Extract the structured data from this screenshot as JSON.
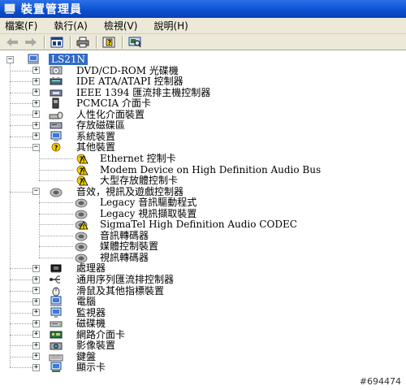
{
  "window": {
    "title": "裝置管理員"
  },
  "menu": [
    {
      "label": "檔案(F)"
    },
    {
      "label": "執行(A)"
    },
    {
      "label": "檢視(V)"
    },
    {
      "label": "說明(H)"
    }
  ],
  "toolbar": {
    "buttons": [
      {
        "icon": "back-arrow-icon"
      },
      {
        "icon": "forward-arrow-icon"
      },
      {
        "icon": "properties-icon"
      },
      {
        "icon": "print-icon"
      },
      {
        "icon": "help-icon"
      },
      {
        "icon": "scan-hardware-icon"
      }
    ]
  },
  "tree": {
    "root": {
      "label": "LS21N",
      "icon": "computer-icon"
    },
    "items": [
      {
        "label": "DVD/CD-ROM 光碟機",
        "icon": "cdrom-icon",
        "state": "collapsed"
      },
      {
        "label": "IDE ATA/ATAPI 控制器",
        "icon": "ide-icon",
        "state": "collapsed"
      },
      {
        "label": "IEEE 1394 匯流排主機控制器",
        "icon": "ieee1394-icon",
        "state": "collapsed"
      },
      {
        "label": "PCMCIA 介面卡",
        "icon": "pcmcia-icon",
        "state": "collapsed"
      },
      {
        "label": "人性化介面裝置",
        "icon": "hid-icon",
        "state": "collapsed"
      },
      {
        "label": "存放磁碟區",
        "icon": "storage-volume-icon",
        "state": "collapsed"
      },
      {
        "label": "系統裝置",
        "icon": "system-device-icon",
        "state": "collapsed"
      },
      {
        "label": "其他裝置",
        "icon": "unknown-device-icon",
        "state": "expanded",
        "children": [
          {
            "label": "Ethernet 控制卡",
            "icon": "unknown-device-warning-icon"
          },
          {
            "label": "Modem Device on High Definition Audio Bus",
            "icon": "unknown-device-warning-icon"
          },
          {
            "label": "大型存放體控制卡",
            "icon": "unknown-device-warning-icon"
          }
        ]
      },
      {
        "label": "音效，視訊及遊戲控制器",
        "icon": "sound-icon",
        "state": "expanded",
        "children": [
          {
            "label": "Legacy 音訊驅動程式",
            "icon": "sound-icon"
          },
          {
            "label": "Legacy 視訊擷取裝置",
            "icon": "sound-icon"
          },
          {
            "label": "SigmaTel High Definition Audio CODEC",
            "icon": "sound-warning-icon"
          },
          {
            "label": "音訊轉碼器",
            "icon": "sound-icon"
          },
          {
            "label": "媒體控制裝置",
            "icon": "sound-icon"
          },
          {
            "label": "視訊轉碼器",
            "icon": "sound-icon"
          }
        ]
      },
      {
        "label": "處理器",
        "icon": "processor-icon",
        "state": "collapsed"
      },
      {
        "label": "通用序列匯流排控制器",
        "icon": "usb-icon",
        "state": "collapsed"
      },
      {
        "label": "滑鼠及其他指標裝置",
        "icon": "mouse-icon",
        "state": "collapsed"
      },
      {
        "label": "電腦",
        "icon": "computer-icon",
        "state": "collapsed"
      },
      {
        "label": "監視器",
        "icon": "monitor-icon",
        "state": "collapsed"
      },
      {
        "label": "磁碟機",
        "icon": "disk-drive-icon",
        "state": "collapsed"
      },
      {
        "label": "網路介面卡",
        "icon": "network-adapter-icon",
        "state": "collapsed"
      },
      {
        "label": "影像裝置",
        "icon": "imaging-device-icon",
        "state": "collapsed"
      },
      {
        "label": "鍵盤",
        "icon": "keyboard-icon",
        "state": "collapsed"
      },
      {
        "label": "顯示卡",
        "icon": "display-adapter-icon",
        "state": "collapsed"
      }
    ]
  },
  "watermark": "#694474",
  "colors": {
    "titlebar": "#0a4fd0",
    "selection": "#316ac5",
    "chrome": "#ece9d8",
    "warning": "#f4d000"
  }
}
